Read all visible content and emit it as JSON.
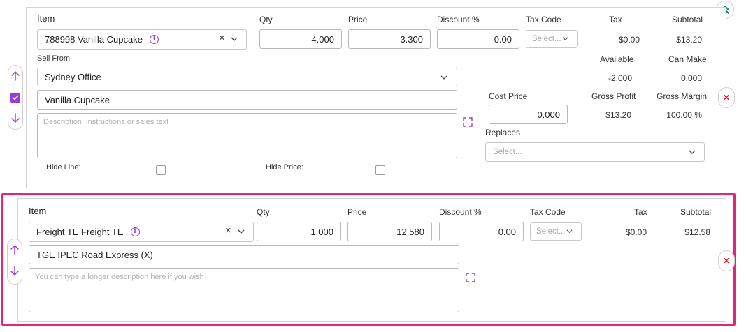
{
  "colors": {
    "accent_purple": "#9b3bd6",
    "highlight_border": "#e0267a",
    "delete_red": "#d9252f",
    "collapse_teal": "#1c8a7a"
  },
  "line1": {
    "headers": {
      "item": "Item",
      "qty": "Qty",
      "price": "Price",
      "discount": "Discount %",
      "tax_code": "Tax Code",
      "tax": "Tax",
      "subtotal": "Subtotal"
    },
    "item_value": "788998 Vanilla Cupcake",
    "qty": "4.000",
    "price": "3.300",
    "discount": "0.00",
    "tax_code_placeholder": "Select...",
    "tax": "$0.00",
    "subtotal": "$13.20",
    "sell_from_label": "Sell From",
    "sell_from_value": "Sydney Office",
    "available_label": "Available",
    "can_make_label": "Can Make",
    "available": "-2.000",
    "can_make": "0.000",
    "name_value": "Vanilla Cupcake",
    "description_placeholder": "Description, instructions or sales text",
    "cost_price_label": "Cost Price",
    "cost_price": "0.000",
    "gross_profit_label": "Gross Profit",
    "gross_margin_label": "Gross Margin",
    "gross_profit": "$13.20",
    "gross_margin": "100.00 %",
    "replaces_label": "Replaces",
    "replaces_placeholder": "Select...",
    "hide_line_label": "Hide Line:",
    "hide_price_label": "Hide Price:"
  },
  "line2": {
    "headers": {
      "item": "Item",
      "qty": "Qty",
      "price": "Price",
      "discount": "Discount %",
      "tax_code": "Tax Code",
      "tax": "Tax",
      "subtotal": "Subtotal"
    },
    "item_value": "Freight TE Freight TE",
    "qty": "1.000",
    "price": "12.580",
    "discount": "0.00",
    "tax_code_placeholder": "Select...",
    "tax": "$0.00",
    "subtotal": "$12.58",
    "name_value": "TGE IPEC Road Express (X)",
    "description_placeholder": "You can type a longer description here if you wish"
  },
  "icons": {
    "info": "i",
    "clear": "×",
    "delete": "✕"
  }
}
